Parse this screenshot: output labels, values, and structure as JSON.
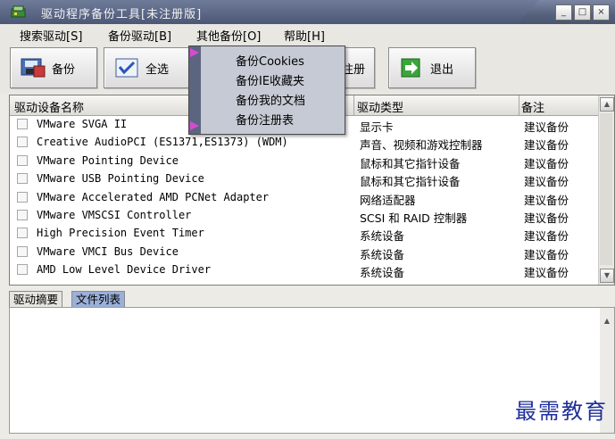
{
  "window": {
    "title": "驱动程序备份工具[未注册版]",
    "controls": [
      "_",
      "□",
      "×"
    ]
  },
  "menu": [
    "搜索驱动[S]",
    "备份驱动[B]",
    "其他备份[O]",
    "帮助[H]"
  ],
  "toolbar": {
    "backup": "备份",
    "select_all": "全选",
    "register": "注册",
    "exit": "退出"
  },
  "dropdown": [
    "备份Cookies",
    "备份IE收藏夹",
    "备份我的文档",
    "备份注册表"
  ],
  "list": {
    "headers": [
      "驱动设备名称",
      "驱动类型",
      "备注"
    ],
    "rows": [
      {
        "name": "VMware SVGA II",
        "type": "显示卡",
        "remark": "建议备份"
      },
      {
        "name": "Creative AudioPCI (ES1371,ES1373) (WDM)",
        "type": "声音、视频和游戏控制器",
        "remark": "建议备份"
      },
      {
        "name": "VMware Pointing Device",
        "type": "鼠标和其它指针设备",
        "remark": "建议备份"
      },
      {
        "name": "VMware USB Pointing Device",
        "type": "鼠标和其它指针设备",
        "remark": "建议备份"
      },
      {
        "name": "VMware Accelerated AMD PCNet Adapter",
        "type": "网络适配器",
        "remark": "建议备份"
      },
      {
        "name": "VMware VMSCSI Controller",
        "type": "SCSI 和 RAID 控制器",
        "remark": "建议备份"
      },
      {
        "name": "High Precision Event Timer",
        "type": "系统设备",
        "remark": "建议备份"
      },
      {
        "name": "VMware VMCI Bus Device",
        "type": "系统设备",
        "remark": "建议备份"
      },
      {
        "name": "AMD Low Level Device Driver",
        "type": "系统设备",
        "remark": "建议备份"
      }
    ]
  },
  "tabs": [
    "驱动摘要",
    "文件列表"
  ],
  "watermark": "最需教育",
  "colors": {
    "titlebar": "#56617c",
    "menu_accent": "#5c6580",
    "watermark": "#1f2f9c"
  }
}
